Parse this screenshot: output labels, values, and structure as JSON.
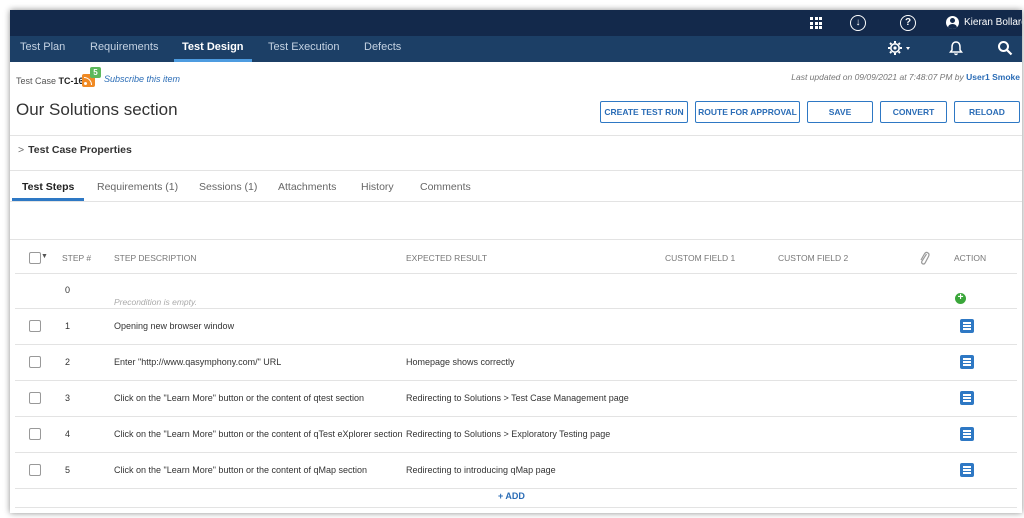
{
  "topbar": {
    "icons": [
      "apps-grid-icon",
      "download-icon",
      "help-icon"
    ],
    "user_name": "Kieran Bollard"
  },
  "nav": {
    "tabs": [
      {
        "label": "Test Plan",
        "active": false
      },
      {
        "label": "Requirements",
        "active": false
      },
      {
        "label": "Test Design",
        "active": true
      },
      {
        "label": "Test Execution",
        "active": false
      },
      {
        "label": "Defects",
        "active": false
      }
    ],
    "icons": [
      "gear-icon",
      "bell-icon",
      "search-icon"
    ]
  },
  "header": {
    "test_case_prefix": "Test Case",
    "test_case_id": "TC-16",
    "rss_badge": "5",
    "subscribe": "Subscribe this item",
    "last_updated_prefix": "Last updated on 09/09/2021 at 7:48:07 PM by",
    "last_updated_user": "User1 Smoke",
    "title": "Our Solutions section"
  },
  "actions": {
    "create_test_run": "CREATE TEST RUN",
    "route_for_approval": "ROUTE FOR APPROVAL",
    "save": "SAVE",
    "convert": "CONVERT",
    "reload": "RELOAD"
  },
  "properties": {
    "label": "Test Case Properties"
  },
  "subtabs": [
    {
      "label": "Test Steps",
      "active": true
    },
    {
      "label": "Requirements (1)",
      "active": false
    },
    {
      "label": "Sessions (1)",
      "active": false
    },
    {
      "label": "Attachments",
      "active": false
    },
    {
      "label": "History",
      "active": false
    },
    {
      "label": "Comments",
      "active": false
    }
  ],
  "table": {
    "columns": {
      "step": "STEP #",
      "description": "STEP DESCRIPTION",
      "expected": "EXPECTED RESULT",
      "custom1": "CUSTOM FIELD 1",
      "custom2": "CUSTOM FIELD 2",
      "action": "ACTION"
    },
    "precondition": {
      "step": "0",
      "text": "Precondition is empty."
    },
    "rows": [
      {
        "step": "1",
        "description": "Opening new browser window",
        "expected": ""
      },
      {
        "step": "2",
        "description": "Enter \"http://www.qasymphony.com/\" URL",
        "expected": "Homepage shows correctly"
      },
      {
        "step": "3",
        "description": "Click on the \"Learn More\" button or the content of qtest section",
        "expected": "Redirecting to Solutions > Test Case Management page"
      },
      {
        "step": "4",
        "description": " Click on the \"Learn More\" button or the content of qTest eXplorer section",
        "expected": "Redirecting to Solutions > Exploratory Testing page"
      },
      {
        "step": "5",
        "description": "Click on the \"Learn More\" button or the content of qMap section",
        "expected": "Redirecting to introducing qMap page"
      }
    ],
    "add_label": "+ ADD"
  }
}
